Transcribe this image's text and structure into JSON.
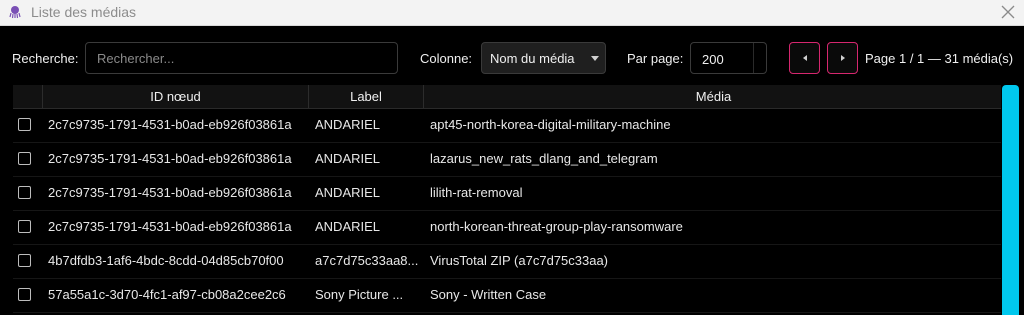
{
  "window": {
    "title": "Liste des médias"
  },
  "toolbar": {
    "search_label": "Recherche:",
    "search_placeholder": "Rechercher...",
    "search_value": "",
    "column_label": "Colonne:",
    "column_value": "Nom du média",
    "per_page_label": "Par page:",
    "per_page_value": "200",
    "page_info": "Page 1 / 1 — 31 média(s)"
  },
  "table": {
    "columns": [
      "ID nœud",
      "Label",
      "Média"
    ],
    "rows": [
      {
        "id": "2c7c9735-1791-4531-b0ad-eb926f03861a",
        "label": "ANDARIEL",
        "media": "apt45-north-korea-digital-military-machine"
      },
      {
        "id": "2c7c9735-1791-4531-b0ad-eb926f03861a",
        "label": "ANDARIEL",
        "media": "lazarus_new_rats_dlang_and_telegram"
      },
      {
        "id": "2c7c9735-1791-4531-b0ad-eb926f03861a",
        "label": "ANDARIEL",
        "media": "lilith-rat-removal"
      },
      {
        "id": "2c7c9735-1791-4531-b0ad-eb926f03861a",
        "label": "ANDARIEL",
        "media": "north-korean-threat-group-play-ransomware"
      },
      {
        "id": "4b7dfdb3-1af6-4bdc-8cdd-04d85cb70f00",
        "label": "a7c7d75c33aa8...",
        "media": "VirusTotal ZIP (a7c7d75c33aa)"
      },
      {
        "id": "57a55a1c-3d70-4fc1-af97-cb08a2cee2c6",
        "label": "Sony Picture ...",
        "media": "Sony - Written Case"
      }
    ]
  },
  "colors": {
    "accent": "#d6276f",
    "scrollbar": "#00c8ee",
    "background": "#000000"
  }
}
